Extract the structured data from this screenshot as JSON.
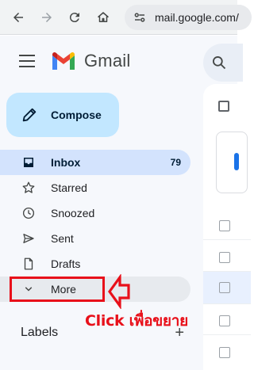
{
  "browser": {
    "url": "mail.google.com/"
  },
  "header": {
    "app_name": "Gmail"
  },
  "compose": {
    "label": "Compose"
  },
  "sidebar": {
    "items": [
      {
        "label": "Inbox",
        "count": "79",
        "icon": "inbox-icon",
        "active": true
      },
      {
        "label": "Starred",
        "icon": "star-icon"
      },
      {
        "label": "Snoozed",
        "icon": "clock-icon"
      },
      {
        "label": "Sent",
        "icon": "send-icon"
      },
      {
        "label": "Drafts",
        "icon": "draft-icon"
      },
      {
        "label": "More",
        "icon": "chevron-down-icon"
      }
    ],
    "labels_heading": "Labels",
    "add_label": "+"
  },
  "annotation": {
    "text": "Click เพื่อขยาย",
    "color": "#e8101a"
  },
  "colors": {
    "compose_bg": "#c2e7ff",
    "active_item_bg": "#d3e3fd",
    "app_bg": "#f6f8fc"
  }
}
